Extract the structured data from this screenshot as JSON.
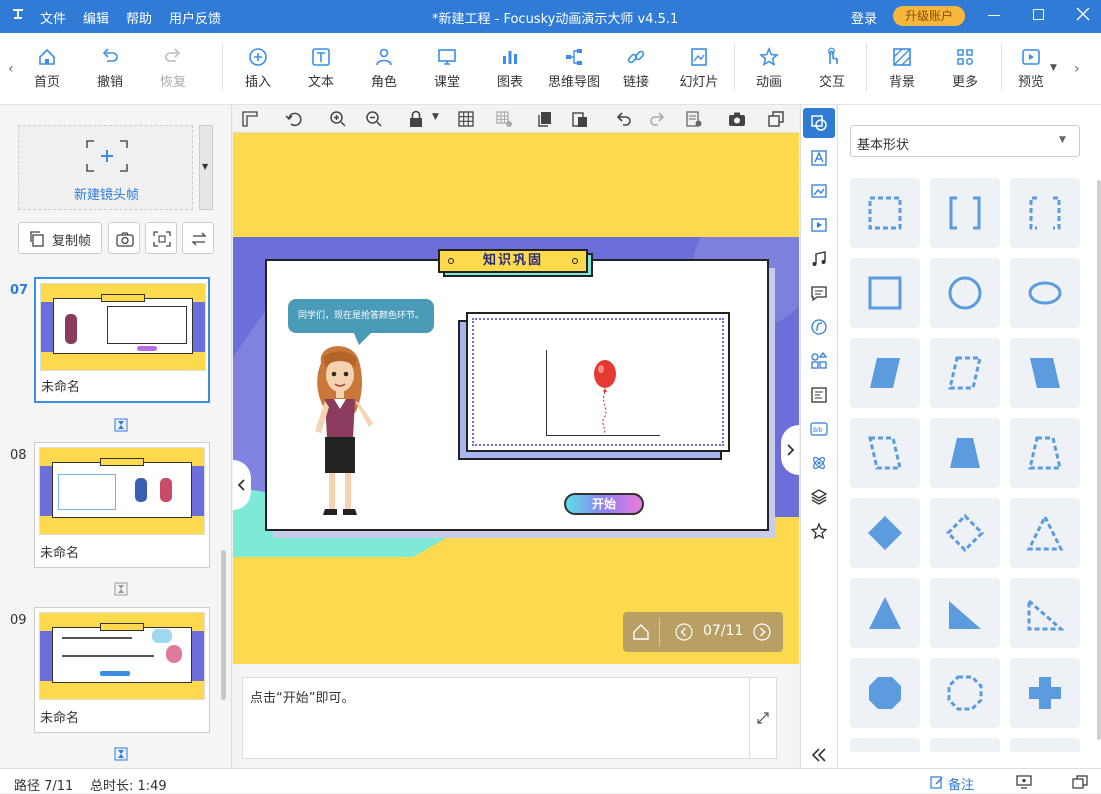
{
  "titlebar": {
    "app_icon": "pin-icon",
    "menus": [
      "文件",
      "编辑",
      "帮助",
      "用户反馈"
    ],
    "title": "*新建工程 - Focusky动画演示大师  v4.5.1",
    "login": "登录",
    "upgrade": "升级账户"
  },
  "toolbar": {
    "items": [
      {
        "label": "首页",
        "icon": "home-icon"
      },
      {
        "label": "撤销",
        "icon": "undo-icon"
      },
      {
        "label": "恢复",
        "icon": "redo-icon"
      },
      {
        "label": "插入",
        "icon": "plus-circle-icon"
      },
      {
        "label": "文本",
        "icon": "text-icon"
      },
      {
        "label": "角色",
        "icon": "person-icon"
      },
      {
        "label": "课堂",
        "icon": "classroom-icon"
      },
      {
        "label": "图表",
        "icon": "chart-icon"
      },
      {
        "label": "思维导图",
        "icon": "mindmap-icon"
      },
      {
        "label": "链接",
        "icon": "link-icon"
      },
      {
        "label": "幻灯片",
        "icon": "slides-icon"
      },
      {
        "label": "动画",
        "icon": "star-icon"
      },
      {
        "label": "交互",
        "icon": "hand-icon"
      },
      {
        "label": "背景",
        "icon": "background-icon"
      },
      {
        "label": "更多",
        "icon": "more-icon"
      },
      {
        "label": "预览",
        "icon": "preview-icon"
      }
    ]
  },
  "left_panel": {
    "new_frame": "新建镜头帧",
    "copy_frame": "复制帧",
    "thumbs": [
      {
        "num": "07",
        "name": "未命名"
      },
      {
        "num": "08",
        "name": "未命名"
      },
      {
        "num": "09",
        "name": "未命名"
      }
    ]
  },
  "slide": {
    "title_banner": "知识巩固",
    "speech": "同学们，现在是抢答颜色环节。",
    "start_button": "开始",
    "page_indicator": "07/11"
  },
  "notes": {
    "text": "点击“开始”即可。"
  },
  "right_panel": {
    "dropdown": "基本形状"
  },
  "statusbar": {
    "path": "路径 7/11",
    "duration": "总时长: 1:49",
    "notes_button": "备注"
  },
  "colors": {
    "accent": "#2f7bd6",
    "upgrade_bg": "#f6b73c",
    "canvas_bg": "#fcd94d",
    "slide_band": "#6c6fd9",
    "mint": "#7fe9d8",
    "shape_fill": "#5b9bde"
  }
}
